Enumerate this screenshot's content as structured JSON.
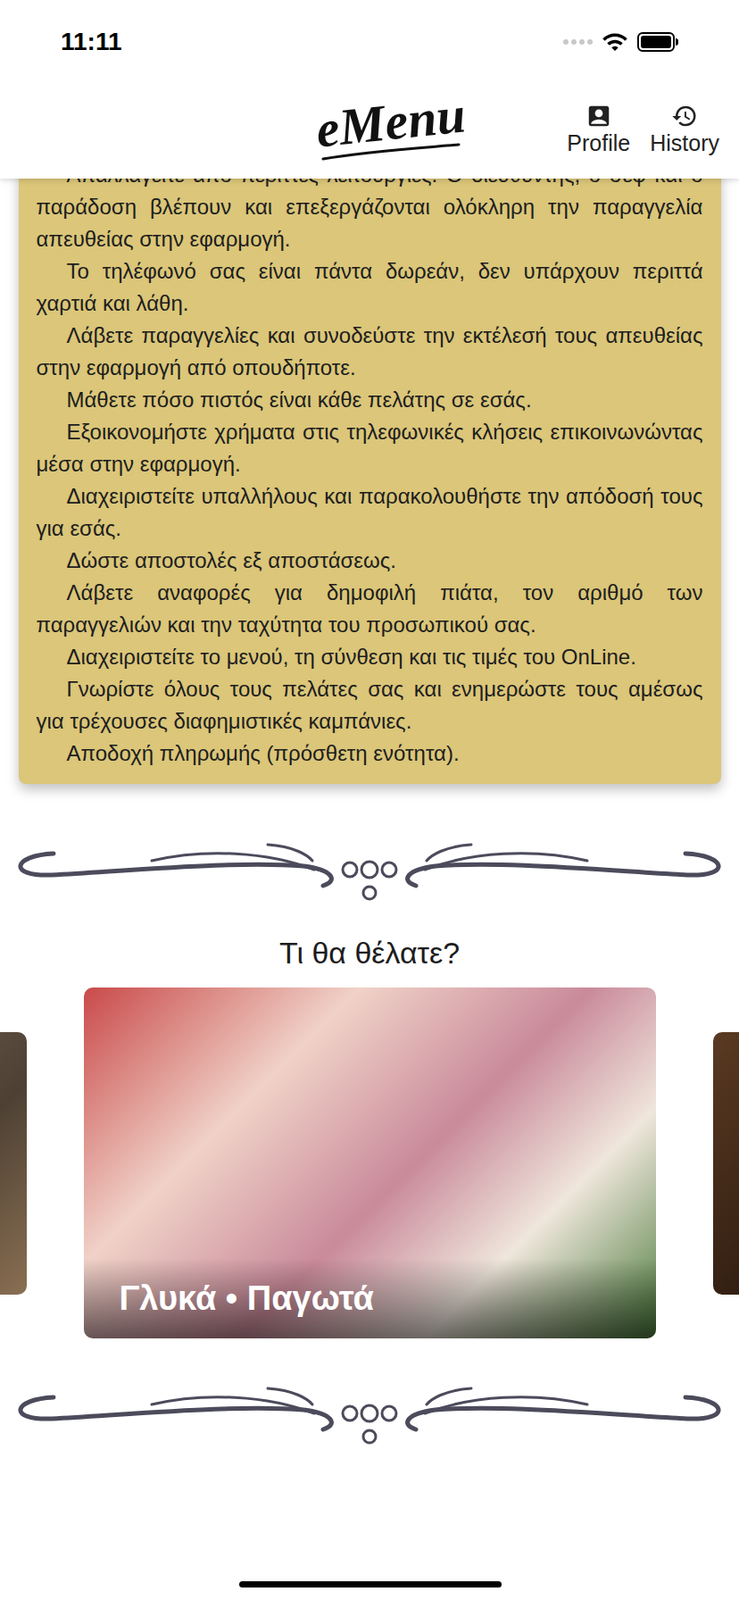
{
  "status_bar": {
    "time": "11:11",
    "signal": {
      "level": 0
    },
    "battery": {
      "level": 1
    }
  },
  "header": {
    "logo": "eMenu",
    "actions": [
      {
        "label": "Profile"
      },
      {
        "label": "History"
      }
    ]
  },
  "features_card": {
    "paragraphs": [
      "Απαλλαγείτε από περιττές λειτουργίες. Ο διευθυντής, ο σεφ και ο παράδοση βλέπουν και επεξεργάζονται ολόκληρη την παραγγελία απευθείας στην εφαρμογή.",
      "Το τηλέφωνό σας είναι πάντα δωρεάν, δεν υπάρχουν περιττά χαρτιά και λάθη.",
      "Λάβετε παραγγελίες και συνοδεύστε την εκτέλεσή τους απευθείας στην εφαρμογή από οπουδήποτε.",
      "Μάθετε πόσο πιστός είναι κάθε πελάτης σε εσάς.",
      "Εξοικονομήστε χρήματα στις τηλεφωνικές κλήσεις επικοινωνώντας μέσα στην εφαρμογή.",
      "Διαχειριστείτε υπαλλήλους και παρακολουθήστε την απόδοσή τους για εσάς.",
      "Δώστε αποστολές εξ αποστάσεως.",
      "Λάβετε αναφορές για δημοφιλή πιάτα, τον αριθμό των παραγγελιών και την ταχύτητα του προσωπικού σας.",
      "Διαχειριστείτε το μενού, τη σύνθεση και τις τιμές του OnLine.",
      "Γνωρίστε όλους τους πελάτες σας και ενημερώστε τους αμέσως για τρέχουσες διαφημιστικές καμπάνιες.",
      "Αποδοχή πληρωμής (πρόσθετη ενότητα)."
    ]
  },
  "section_title": "Τι θα θέλατε?",
  "carousel": {
    "items": [
      {
        "label": "",
        "selected": false
      },
      {
        "label": "Γλυκά • Παγωτά",
        "selected": true
      },
      {
        "label": "",
        "selected": false
      }
    ]
  }
}
